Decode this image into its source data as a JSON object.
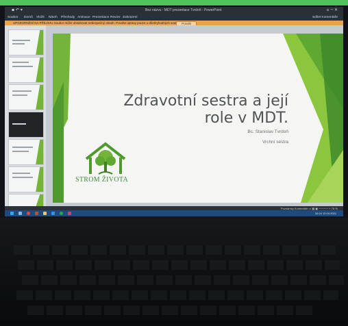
{
  "window": {
    "title": "Bez názvu - MDT prezentace Tvrdoň - PowerPoint",
    "left_controls": "▪ ↶ ▾",
    "right_controls": "▫  ─  ✕"
  },
  "menubar": {
    "items": [
      "Soubor",
      "Domů",
      "Vložit",
      "Návrh",
      "Přechody",
      "Animace",
      "Prezentace",
      "Revize",
      "Zobrazení"
    ],
    "right": "Sdílet  Komentáře"
  },
  "banner": {
    "text": "UPOZORNĚNÍ NA PŘÍLOHU   Soubor může obsahovat nebezpečný obsah. Povolte úpravy pouze u důvěryhodných souborů.",
    "button": "Povolit úpravy"
  },
  "thumbnails": [
    {
      "num": "1"
    },
    {
      "num": "2"
    },
    {
      "num": "3"
    },
    {
      "num": "4"
    },
    {
      "num": "5"
    },
    {
      "num": "6"
    },
    {
      "num": "7"
    }
  ],
  "slide": {
    "title_line1": "Zdravotní sestra a její",
    "title_line2": "role v MDT.",
    "author": "Bc. Stanislav Tvrdoň",
    "position": "Vrchní sestra",
    "logo_text": "STROM ŽIVOTA"
  },
  "statusbar": {
    "right": "Poznámky   Komentáře    ▭  ▦  ▣    ─────  +  76 %"
  },
  "taskbar": {
    "time": "10:24   12.04.2021"
  },
  "colors": {
    "accent_green": "#74b43a",
    "dark_green": "#3f8a3a",
    "taskbar_blue": "#1e4b7f",
    "banner_orange": "#e9a24f"
  }
}
